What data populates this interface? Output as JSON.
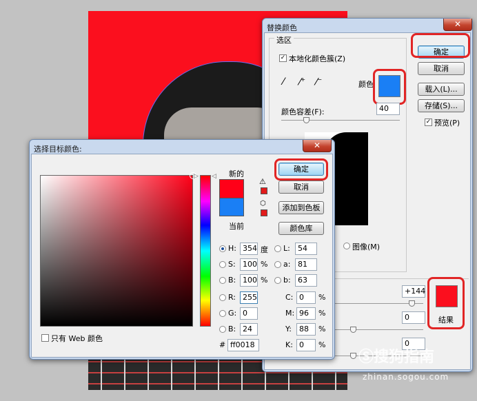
{
  "replace_dialog": {
    "title": "替换颜色",
    "selection_group": "选区",
    "localized_clusters_label": "本地化颜色簇(Z)",
    "localized_clusters_checked": true,
    "color_label": "颜色",
    "selection_color": "#1a7ff5",
    "fuzziness_label": "颜色容差(F):",
    "fuzziness_value": "40",
    "image_radio_label": "图像(M)",
    "ok_label": "确定",
    "cancel_label": "取消",
    "load_label": "载入(L)...",
    "save_label": "存储(S)...",
    "preview_label": "预览(P)",
    "preview_checked": true,
    "hue_value": "+144",
    "saturation_value": "0",
    "lightness_value": "0",
    "result_label": "结果",
    "result_color": "#fb0f1e"
  },
  "picker_dialog": {
    "title": "选择目标颜色:",
    "new_label": "新的",
    "current_label": "当前",
    "new_color": "#ff0018",
    "current_color": "#1a7ff5",
    "ok_label": "确定",
    "cancel_label": "取消",
    "add_swatch_label": "添加到色板",
    "color_libraries_label": "颜色库",
    "web_only_label": "只有 Web 颜色",
    "fields": {
      "H": {
        "label": "H:",
        "value": "354",
        "unit": "度"
      },
      "S": {
        "label": "S:",
        "value": "100",
        "unit": "%"
      },
      "B": {
        "label": "B:",
        "value": "100",
        "unit": "%"
      },
      "L": {
        "label": "L:",
        "value": "54"
      },
      "a": {
        "label": "a:",
        "value": "81"
      },
      "b": {
        "label": "b:",
        "value": "63"
      },
      "R": {
        "label": "R:",
        "value": "255"
      },
      "G": {
        "label": "G:",
        "value": "0"
      },
      "Bl": {
        "label": "B:",
        "value": "24"
      },
      "C": {
        "label": "C:",
        "value": "0",
        "unit": "%"
      },
      "M": {
        "label": "M:",
        "value": "96",
        "unit": "%"
      },
      "Y": {
        "label": "Y:",
        "value": "88",
        "unit": "%"
      },
      "K": {
        "label": "K:",
        "value": "0",
        "unit": "%"
      },
      "hex_label": "#",
      "hex": "ff0018"
    }
  },
  "watermark": {
    "brand": "搜狗指南",
    "url": "zhinan.sogou.com"
  }
}
